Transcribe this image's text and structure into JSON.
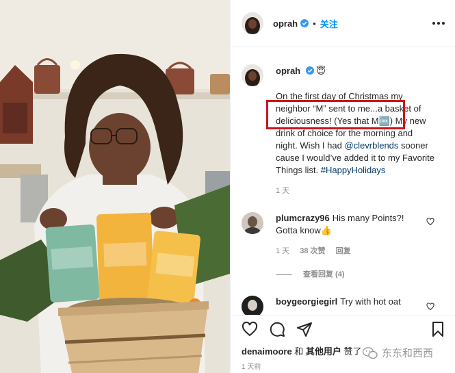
{
  "post": {
    "media_alt": "",
    "author": "oprah",
    "follow_label": "关注"
  },
  "caption": {
    "author": "oprah",
    "author_suffix": "😇",
    "text_before_handle": "On the first day of Christmas my neighbor “M” sent to me...a basket of deliciousness! (Yes that M🆒) My new drink of choice for the morning and night. Wish I had ",
    "handle": "@clevrblends",
    "text_after_handle": " sooner cause I would’ve added it to my Favorite Things list. ",
    "hashtag": "#HappyHolidays",
    "time": "1 天"
  },
  "comments": [
    {
      "author": "plumcrazy96",
      "text": "His many Points?! Gotta know👍",
      "time": "1 天",
      "likes": "38 次赞",
      "reply": "回复",
      "view_replies": "查看回复 (4)"
    },
    {
      "author": "boygeorgiegirl",
      "text": "Try with hot oat"
    }
  ],
  "actions": {
    "like_icon": "heart-icon",
    "comment_icon": "comment-icon",
    "share_icon": "share-icon",
    "save_icon": "bookmark-icon",
    "liked_by_user": "denaimoore",
    "liked_by_mid": " 和 ",
    "liked_by_others": "其他用户",
    "liked_by_end": " 赞了",
    "post_time": "1 天前"
  },
  "watermark": {
    "text": "东东和西西"
  },
  "colors": {
    "accent": "#0095f6",
    "link": "#00376b",
    "highlight_box": "#c8171e",
    "muted": "#8e8e8e"
  }
}
